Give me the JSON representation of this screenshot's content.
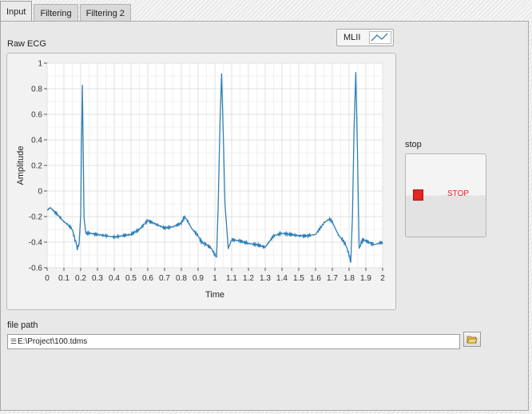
{
  "tabs": [
    {
      "label": "Input",
      "active": true
    },
    {
      "label": "Filtering",
      "active": false
    },
    {
      "label": "Filtering 2",
      "active": false
    }
  ],
  "graph": {
    "title": "Raw ECG",
    "legend_label": "MLII",
    "legend_icon": "line-plot-icon"
  },
  "chart_data": {
    "type": "line",
    "xlabel": "Time",
    "ylabel": "Amplitude",
    "xlim": [
      0,
      2
    ],
    "ylim": [
      -0.6,
      1
    ],
    "x_ticks": [
      "0",
      "0.1",
      "0.2",
      "0.3",
      "0.4",
      "0.5",
      "0.6",
      "0.7",
      "0.8",
      "0.9",
      "1",
      "1.1",
      "1.2",
      "1.3",
      "1.4",
      "1.5",
      "1.6",
      "1.7",
      "1.8",
      "1.9",
      "2"
    ],
    "y_ticks": [
      "1",
      "0.8",
      "0.6",
      "0.4",
      "0.2",
      "0",
      "-0.2",
      "-0.4",
      "-0.6"
    ],
    "grid": true,
    "line_color": "#2f7fb5",
    "series": [
      {
        "x": [
          0,
          0.02,
          0.05,
          0.08,
          0.1,
          0.12,
          0.15,
          0.17,
          0.18,
          0.19,
          0.2,
          0.205,
          0.21,
          0.215,
          0.22,
          0.23,
          0.25,
          0.3,
          0.35,
          0.4,
          0.45,
          0.5,
          0.55,
          0.6,
          0.65,
          0.7,
          0.75,
          0.8,
          0.82,
          0.84,
          0.86,
          0.88,
          0.9,
          0.92,
          0.95,
          0.98,
          1.0,
          1.01,
          1.02,
          1.03,
          1.04,
          1.05,
          1.06,
          1.08,
          1.1,
          1.15,
          1.2,
          1.25,
          1.3,
          1.35,
          1.4,
          1.45,
          1.5,
          1.55,
          1.6,
          1.65,
          1.68,
          1.7,
          1.72,
          1.74,
          1.76,
          1.78,
          1.8,
          1.81,
          1.82,
          1.83,
          1.84,
          1.85,
          1.86,
          1.88,
          1.9,
          1.95,
          2.0
        ],
        "y": [
          -0.15,
          -0.13,
          -0.17,
          -0.21,
          -0.24,
          -0.26,
          -0.3,
          -0.4,
          -0.45,
          -0.42,
          -0.2,
          0.35,
          0.83,
          0.3,
          -0.2,
          -0.33,
          -0.33,
          -0.34,
          -0.35,
          -0.36,
          -0.35,
          -0.34,
          -0.3,
          -0.23,
          -0.26,
          -0.29,
          -0.28,
          -0.25,
          -0.2,
          -0.24,
          -0.29,
          -0.32,
          -0.35,
          -0.4,
          -0.42,
          -0.45,
          -0.5,
          -0.52,
          -0.1,
          0.5,
          0.92,
          0.45,
          -0.1,
          -0.45,
          -0.38,
          -0.39,
          -0.41,
          -0.42,
          -0.44,
          -0.35,
          -0.33,
          -0.34,
          -0.35,
          -0.35,
          -0.34,
          -0.25,
          -0.22,
          -0.24,
          -0.3,
          -0.35,
          -0.38,
          -0.42,
          -0.5,
          -0.56,
          -0.2,
          0.5,
          0.93,
          0.3,
          -0.45,
          -0.38,
          -0.39,
          -0.42,
          -0.4
        ]
      }
    ]
  },
  "stop_button": {
    "caption": "stop",
    "label": "STOP"
  },
  "file_path": {
    "label": "file path",
    "value": "E:\\Project\\100.tdms"
  }
}
